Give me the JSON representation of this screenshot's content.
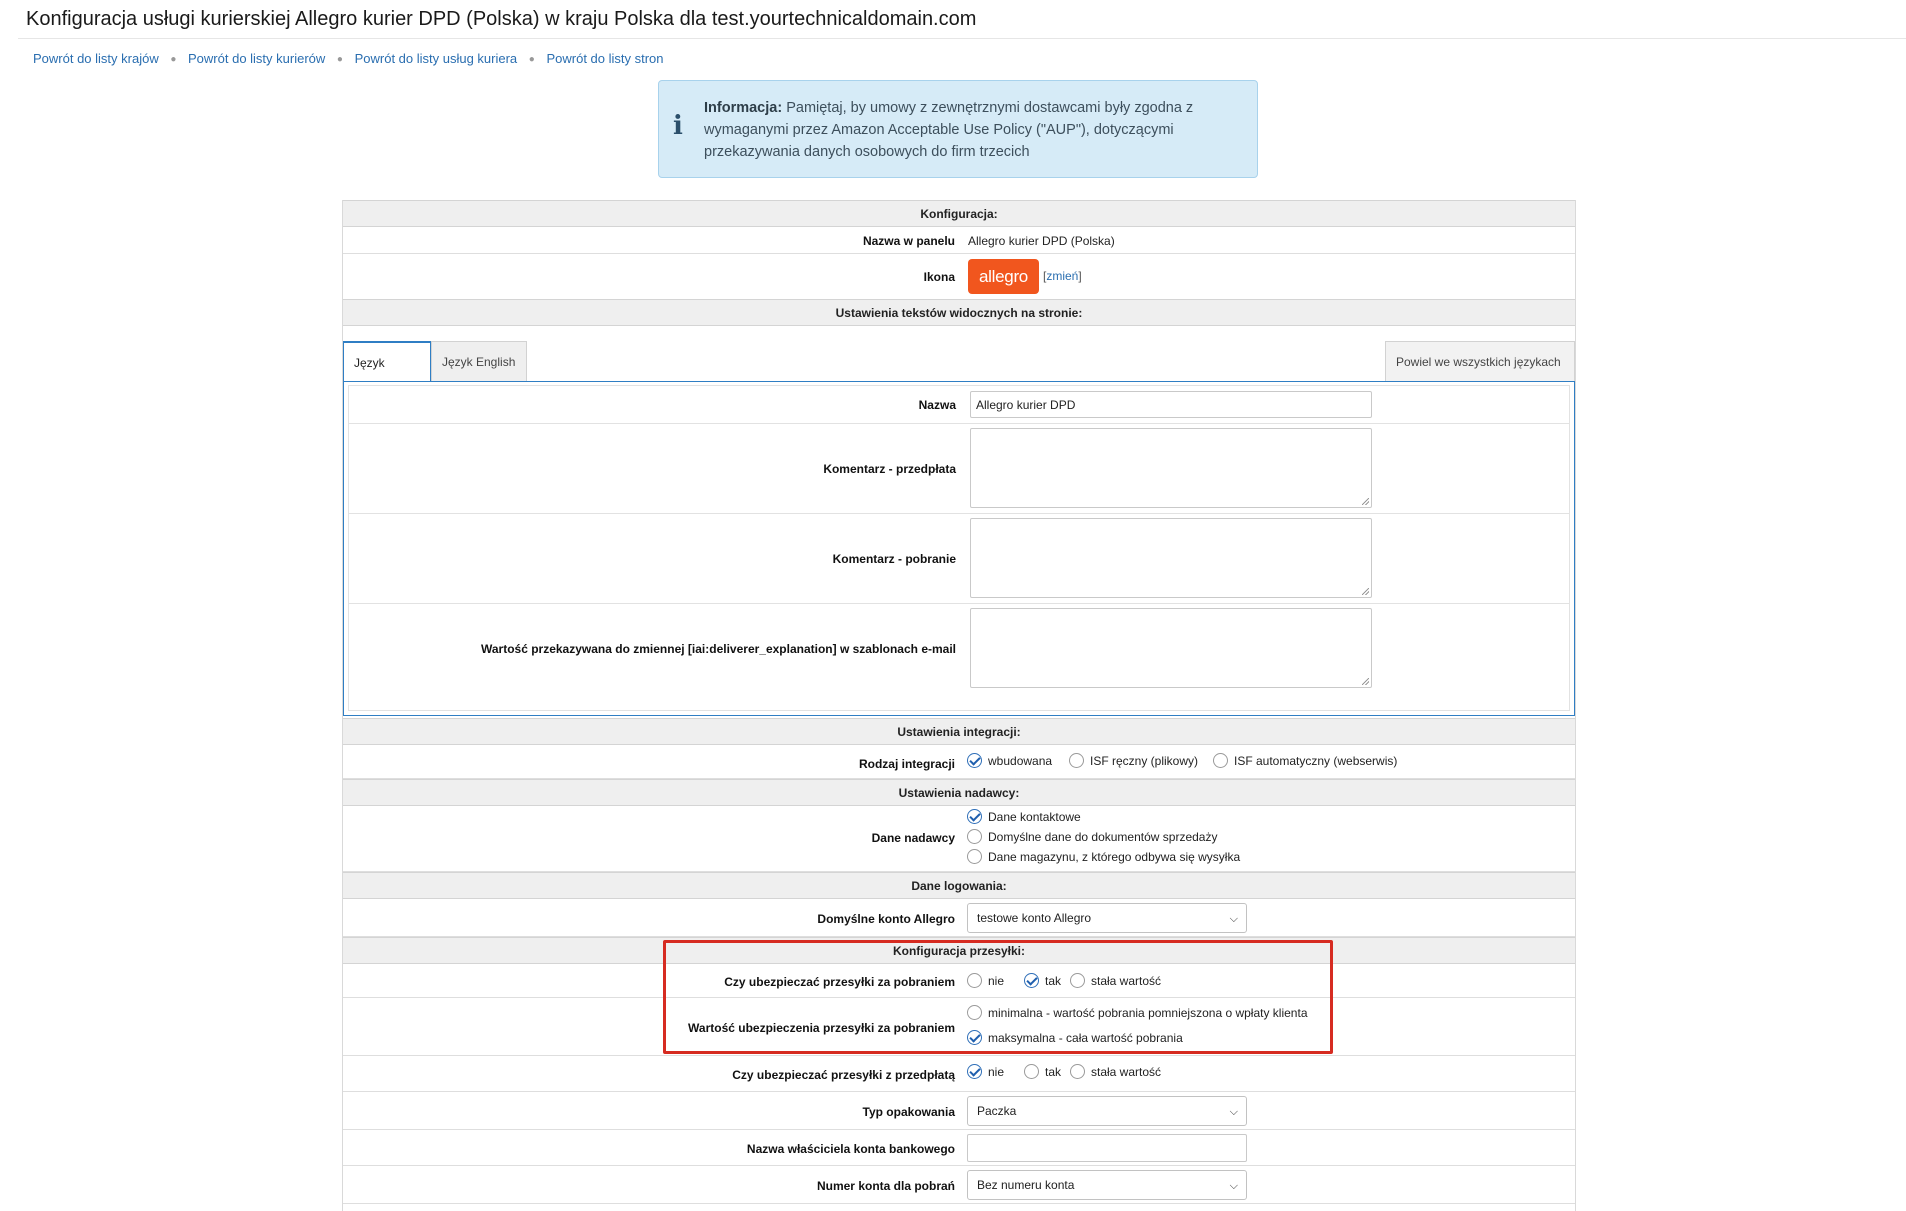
{
  "page": {
    "title": "Konfiguracja usługi kurierskiej Allegro kurier DPD (Polska) w kraju Polska dla test.yourtechnicaldomain.com"
  },
  "breadcrumb": [
    {
      "label": "Powrót do listy krajów"
    },
    {
      "label": "Powrót do listy kurierów"
    },
    {
      "label": "Powrót do listy usług kuriera"
    },
    {
      "label": "Powrót do listy stron"
    }
  ],
  "info": {
    "prefix": "Informacja:",
    "text": "Pamiętaj, by umowy z zewnętrznymi dostawcami były zgodna z wymaganymi przez Amazon Acceptable Use Policy (\"AUP\"), dotyczącymi przekazywania danych osobowych do firm trzecich",
    "icon": "info-icon"
  },
  "config": {
    "section": "Konfiguracja:",
    "panel_name_label": "Nazwa w panelu",
    "panel_name_value": "Allegro kurier DPD (Polska)",
    "icon_label": "Ikona",
    "icon_logo_text": "allegro",
    "icon_change_link": "zmień",
    "icon_change_open": "[",
    "icon_change_close": "]",
    "brand_color": "#f1561e"
  },
  "texts": {
    "section": "Ustawienia tekstów widocznych na stronie:",
    "tabs": [
      {
        "label": "Język Polski",
        "active": true
      },
      {
        "label": "Język English",
        "active": false
      }
    ],
    "repeat_button": "Powiel we wszystkich językach",
    "name_label": "Nazwa",
    "name_value": "Allegro kurier DPD",
    "prepaid_comment_label": "Komentarz - przedpłata",
    "prepaid_comment_value": "",
    "cod_comment_label": "Komentarz - pobranie",
    "cod_comment_value": "",
    "email_var_label": "Wartość przekazywana do zmiennej [iai:deliverer_explanation] w szablonach e-mail",
    "email_var_value": ""
  },
  "integration": {
    "section": "Ustawienia integracji:",
    "type_label": "Rodzaj integracji",
    "options": [
      {
        "label": "wbudowana",
        "checked": true
      },
      {
        "label": "ISF ręczny (plikowy)",
        "checked": false
      },
      {
        "label": "ISF automatyczny (webserwis)",
        "checked": false
      }
    ]
  },
  "sender": {
    "section": "Ustawienia nadawcy:",
    "data_label": "Dane nadawcy",
    "options": [
      {
        "label": "Dane kontaktowe",
        "checked": true
      },
      {
        "label": "Domyślne dane do dokumentów sprzedaży",
        "checked": false
      },
      {
        "label": "Dane magazynu, z którego odbywa się wysyłka",
        "checked": false
      }
    ]
  },
  "login": {
    "section": "Dane logowania:",
    "account_label": "Domyślne konto Allegro",
    "account_value": "testowe konto Allegro"
  },
  "shipment": {
    "section": "Konfiguracja przesyłki:",
    "insure_cod_label": "Czy ubezpieczać przesyłki za pobraniem",
    "insure_cod_options": [
      {
        "label": "nie",
        "checked": false
      },
      {
        "label": "tak",
        "checked": true
      },
      {
        "label": "stała wartość",
        "checked": false
      }
    ],
    "insure_cod_value_label": "Wartość ubezpieczenia przesyłki za pobraniem",
    "insure_cod_value_options": [
      {
        "label": "minimalna - wartość pobrania pomniejszona o wpłaty klienta",
        "checked": false
      },
      {
        "label": "maksymalna - cała wartość pobrania",
        "checked": true
      }
    ],
    "insure_prepaid_label": "Czy ubezpieczać przesyłki z przedpłatą",
    "insure_prepaid_options": [
      {
        "label": "nie",
        "checked": true
      },
      {
        "label": "tak",
        "checked": false
      },
      {
        "label": "stała wartość",
        "checked": false
      }
    ],
    "packaging_label": "Typ opakowania",
    "packaging_value": "Paczka",
    "bank_owner_label": "Nazwa właściciela konta bankowego",
    "bank_owner_value": "",
    "cod_account_label": "Numer konta dla pobrań",
    "cod_account_value": "Bez numeru konta",
    "highlight_color": "#d62b21"
  }
}
